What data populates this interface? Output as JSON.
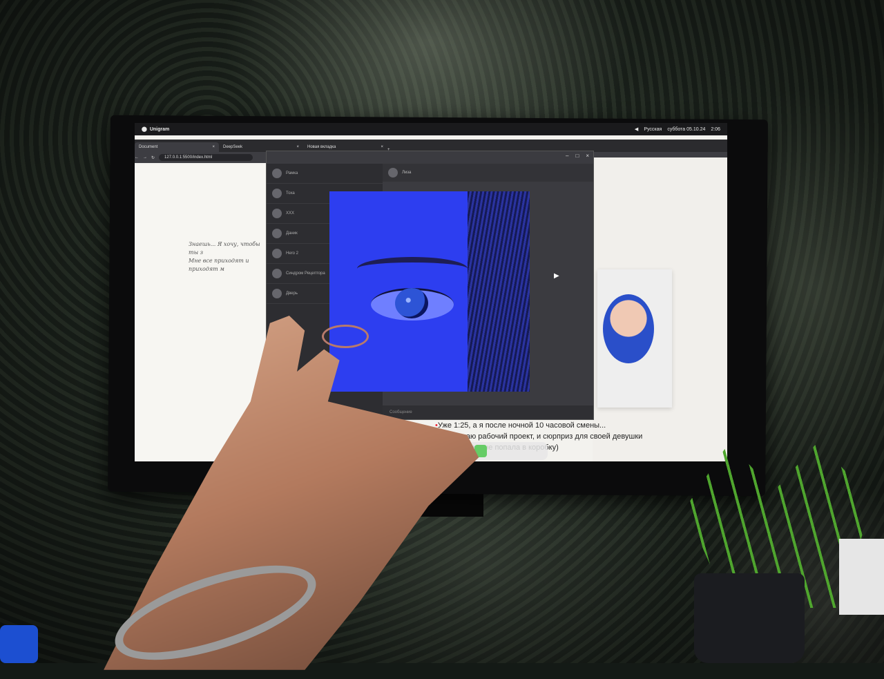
{
  "os_bar": {
    "app_name": "Unigram",
    "language": "Русская",
    "datetime": "суббота 05.10.24",
    "time": "2:06"
  },
  "browser": {
    "tabs": [
      {
        "label": "Document",
        "active": true
      },
      {
        "label": "DeepSeek",
        "active": false
      },
      {
        "label": "Новая вкладка",
        "active": false
      }
    ],
    "new_tab": "+",
    "url": "127.0.0.1:5500/index.html"
  },
  "page": {
    "script_line_1": "Знаешь... Я хочу, чтобы ты з",
    "script_line_2": "Мне все приходят и приходят м",
    "message_line_1": "Уже 1:25, а я после ночной 10 часовой смены...",
    "message_line_2": "Но... делаю рабочий проект, и сюрприз для своей девушки",
    "message_line_3": "которая так и не попала в коробку)"
  },
  "telegram": {
    "window_title": "Unigram",
    "input_placeholder": "Сообщение",
    "chats": [
      {
        "name": "Рамка"
      },
      {
        "name": "Тоха"
      },
      {
        "name": "XXX"
      },
      {
        "name": "Даник"
      },
      {
        "name": "Hero 2"
      },
      {
        "name": "Синдром Рецептора"
      },
      {
        "name": "Дверь"
      }
    ],
    "header_name": "Лиза"
  },
  "colors": {
    "eye_blue": "#2d3ef0",
    "accent_red": "#e23"
  },
  "icons": [
    "telegram-icon",
    "yandex-icon",
    "terminal-icon",
    "recycle-icon",
    "cursor-icon"
  ]
}
